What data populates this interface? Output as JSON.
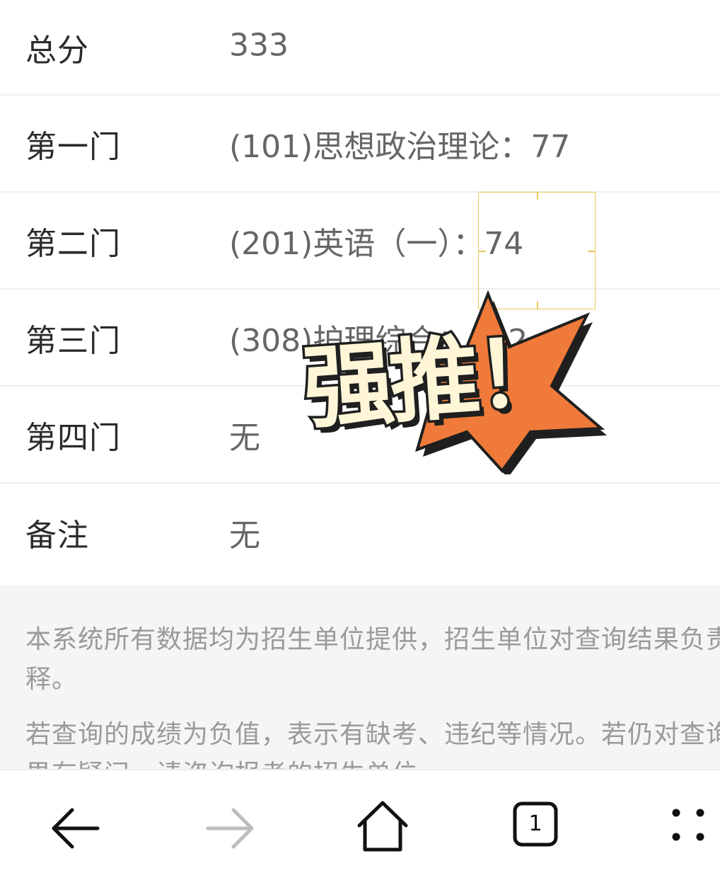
{
  "scores": [
    {
      "label": "总分",
      "value": "333"
    },
    {
      "label": "第一门",
      "value": "(101)思想政治理论：77"
    },
    {
      "label": "第二门",
      "value": "(201)英语（一）：74"
    },
    {
      "label": "第三门",
      "value": "(308)护理综合：182"
    },
    {
      "label": "第四门",
      "value": "无"
    },
    {
      "label": "备注",
      "value": "无"
    }
  ],
  "notice": {
    "paragraph1": "本系统所有数据均为招生单位提供，招生单位对查询结果负责解释。",
    "paragraph2": "若查询的成绩为负值，表示有缺考、违纪等情况。若仍对查询结果有疑问，请咨询报考的招生单位。"
  },
  "sticker": {
    "text": "强推！",
    "colors": {
      "burst": "#f07a3a",
      "text": "#fff6d8",
      "outline": "#1f1f1f"
    }
  },
  "nav": {
    "tab_count": "1",
    "icons": [
      "arrow-left-icon",
      "arrow-right-icon",
      "home-icon",
      "tabs-icon",
      "menu-dots-icon"
    ]
  }
}
